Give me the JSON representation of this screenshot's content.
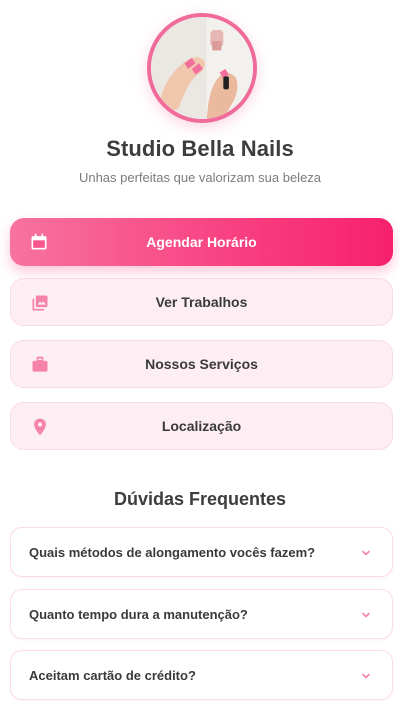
{
  "profile": {
    "title": "Studio Bella Nails",
    "subtitle": "Unhas perfeitas que valorizam sua beleza"
  },
  "actions": [
    {
      "label": "Agendar Horário",
      "icon": "calendar-icon"
    },
    {
      "label": "Ver Trabalhos",
      "icon": "gallery-icon"
    },
    {
      "label": "Nossos Serviços",
      "icon": "briefcase-icon"
    },
    {
      "label": "Localização",
      "icon": "location-pin-icon"
    }
  ],
  "faq": {
    "heading": "Dúvidas Frequentes",
    "items": [
      {
        "question": "Quais métodos de alongamento vocês fazem?"
      },
      {
        "question": "Quanto tempo dura a manutenção?"
      },
      {
        "question": "Aceitam cartão de crédito?"
      }
    ]
  },
  "colors": {
    "accent": "#f83f80",
    "button_bg": "#fdeef3",
    "icon": "#f582ab"
  }
}
